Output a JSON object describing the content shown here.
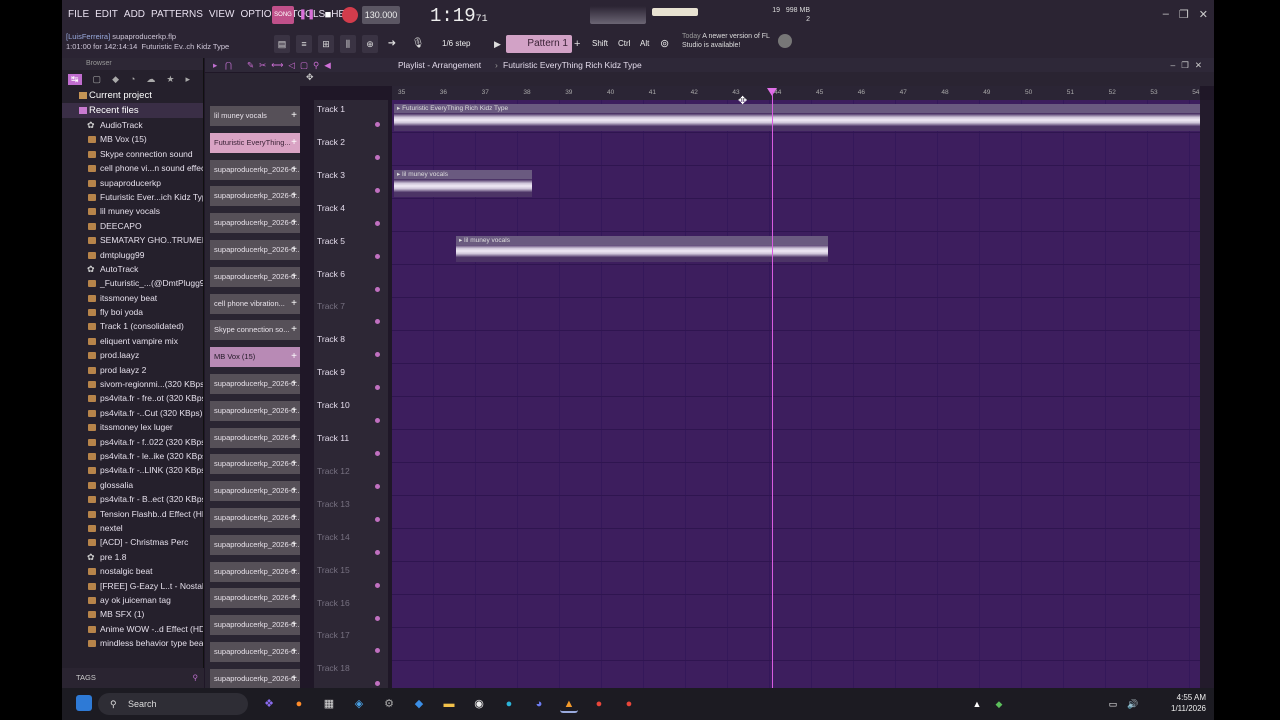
{
  "menu": [
    "FILE",
    "EDIT",
    "ADD",
    "PATTERNS",
    "VIEW",
    "OPTIONS",
    "TOOLS",
    "HELP"
  ],
  "transport": {
    "tempo": "130.000",
    "time": "1:19",
    "time_sub": "71",
    "cpu": "19",
    "mem": "998 MB",
    "voices": "2"
  },
  "hint": {
    "user": "[LuisFerreira]",
    "file": "supaproducerkp.flp",
    "time": "1:01:00 for 142:14:14",
    "name": "Futuristic Ev..ch Kidz Type"
  },
  "snap": "1/6 step",
  "pattern": "Pattern 1",
  "shift": "Shift",
  "ctrl": "Ctrl",
  "alt": "Alt",
  "news": {
    "today": "Today",
    "text": "A newer version of FL Studio is available!"
  },
  "browser": {
    "title": "Browser",
    "current_project": "Current project",
    "recent_files": "Recent files",
    "items": [
      {
        "label": "AudioTrack",
        "icon": "gear"
      },
      {
        "label": "MB Vox (15)",
        "icon": "file"
      },
      {
        "label": "Skype connection sound",
        "icon": "file"
      },
      {
        "label": "cell phone vi...n sound effect",
        "icon": "file"
      },
      {
        "label": "supaproducerkp",
        "icon": "file"
      },
      {
        "label": "Futuristic Ever...ich Kidz Type",
        "icon": "file"
      },
      {
        "label": "lil muney vocals",
        "icon": "file"
      },
      {
        "label": "DEECAPO",
        "icon": "file"
      },
      {
        "label": "SEMATARY GHO..TRUMENTAL",
        "icon": "file"
      },
      {
        "label": "dmtplugg99",
        "icon": "file"
      },
      {
        "label": "AutoTrack",
        "icon": "gear"
      },
      {
        "label": "_Futuristic_...(@DmtPlugg99)",
        "icon": "file"
      },
      {
        "label": "itssmoney beat",
        "icon": "file"
      },
      {
        "label": "fly boi yoda",
        "icon": "file"
      },
      {
        "label": "Track 1 (consolidated)",
        "icon": "file"
      },
      {
        "label": "eliquent vampire mix",
        "icon": "file"
      },
      {
        "label": "prod.laayz",
        "icon": "file"
      },
      {
        "label": "prod laayz 2",
        "icon": "file"
      },
      {
        "label": "sivom-regionmi...(320 KBps)",
        "icon": "file"
      },
      {
        "label": "ps4vita.fr - fre..ot (320 KBps)",
        "icon": "file"
      },
      {
        "label": "ps4vita.fr -..Cut (320 KBps)",
        "icon": "file"
      },
      {
        "label": "itssmoney lex luger",
        "icon": "file"
      },
      {
        "label": "ps4vita.fr - f..022 (320 KBps)",
        "icon": "file"
      },
      {
        "label": "ps4vita.fr - le..ike (320 KBps)",
        "icon": "file"
      },
      {
        "label": "ps4vita.fr -..LINK (320 KBps)",
        "icon": "file"
      },
      {
        "label": "glossalia",
        "icon": "file"
      },
      {
        "label": "ps4vita.fr - B..ect (320 KBps)",
        "icon": "file"
      },
      {
        "label": "Tension Flashb..d Effect (HD)",
        "icon": "file"
      },
      {
        "label": "nextel",
        "icon": "file"
      },
      {
        "label": "[ACD] - Christmas Perc",
        "icon": "file"
      },
      {
        "label": "pre 1.8",
        "icon": "gear"
      },
      {
        "label": "nostalgic beat",
        "icon": "file"
      },
      {
        "label": "[FREE] G-Eazy L..t - Nostalgic",
        "icon": "file"
      },
      {
        "label": "ay ok juiceman tag",
        "icon": "file"
      },
      {
        "label": "MB SFX (1)",
        "icon": "file"
      },
      {
        "label": "Anime WOW -..d Effect (HD)",
        "icon": "file"
      },
      {
        "label": "mindless behavior type beat",
        "icon": "file"
      }
    ],
    "tags": "TAGS"
  },
  "patterns": [
    {
      "label": "lil muney vocals",
      "style": "plain"
    },
    {
      "label": "Futuristic EveryThing...",
      "style": "pink"
    },
    {
      "label": "supaproducerkp_2026-0...",
      "style": "plain"
    },
    {
      "label": "supaproducerkp_2026-0...",
      "style": "plain"
    },
    {
      "label": "supaproducerkp_2026-0...",
      "style": "plain"
    },
    {
      "label": "supaproducerkp_2026-0...",
      "style": "plain"
    },
    {
      "label": "supaproducerkp_2026-0...",
      "style": "plain"
    },
    {
      "label": "cell phone vibration...",
      "style": "plain"
    },
    {
      "label": "Skype connection so...",
      "style": "plain"
    },
    {
      "label": "MB Vox (15)",
      "style": "pink2"
    },
    {
      "label": "supaproducerkp_2026-0...",
      "style": "plain"
    },
    {
      "label": "supaproducerkp_2026-0...",
      "style": "plain"
    },
    {
      "label": "supaproducerkp_2026-0...",
      "style": "plain"
    },
    {
      "label": "supaproducerkp_2026-0...",
      "style": "plain"
    },
    {
      "label": "supaproducerkp_2026-0...",
      "style": "plain"
    },
    {
      "label": "supaproducerkp_2026-0...",
      "style": "plain"
    },
    {
      "label": "supaproducerkp_2026-0...",
      "style": "plain"
    },
    {
      "label": "supaproducerkp_2026-0...",
      "style": "plain"
    },
    {
      "label": "supaproducerkp_2026-0...",
      "style": "plain"
    },
    {
      "label": "supaproducerkp_2026-0...",
      "style": "plain"
    },
    {
      "label": "supaproducerkp_2026-0...",
      "style": "plain"
    },
    {
      "label": "supaproducerkp_2026-0...",
      "style": "plain"
    }
  ],
  "playlist": {
    "title": "Playlist - Arrangement",
    "arrangement": "Futuristic EveryThing Rich Kidz Type",
    "ruler": [
      "35",
      "36",
      "37",
      "38",
      "39",
      "40",
      "41",
      "42",
      "43",
      "44",
      "45",
      "46",
      "47",
      "48",
      "49",
      "50",
      "51",
      "52",
      "53",
      "54"
    ],
    "tracks": [
      "Track 1",
      "Track 2",
      "Track 3",
      "Track 4",
      "Track 5",
      "Track 6",
      "Track 7",
      "Track 8",
      "Track 9",
      "Track 10",
      "Track 11",
      "Track 12",
      "Track 13",
      "Track 14",
      "Track 15",
      "Track 16",
      "Track 17",
      "Track 18"
    ],
    "clips": [
      {
        "label": "Futuristic EveryThing Rich Kidz Type",
        "track": 1
      },
      {
        "label": "lil muney vocals",
        "track": 3
      },
      {
        "label": "lil muney vocals",
        "track": 5
      }
    ]
  },
  "taskbar": {
    "search": "Search",
    "time": "4:55 AM",
    "date": "1/11/2026"
  }
}
